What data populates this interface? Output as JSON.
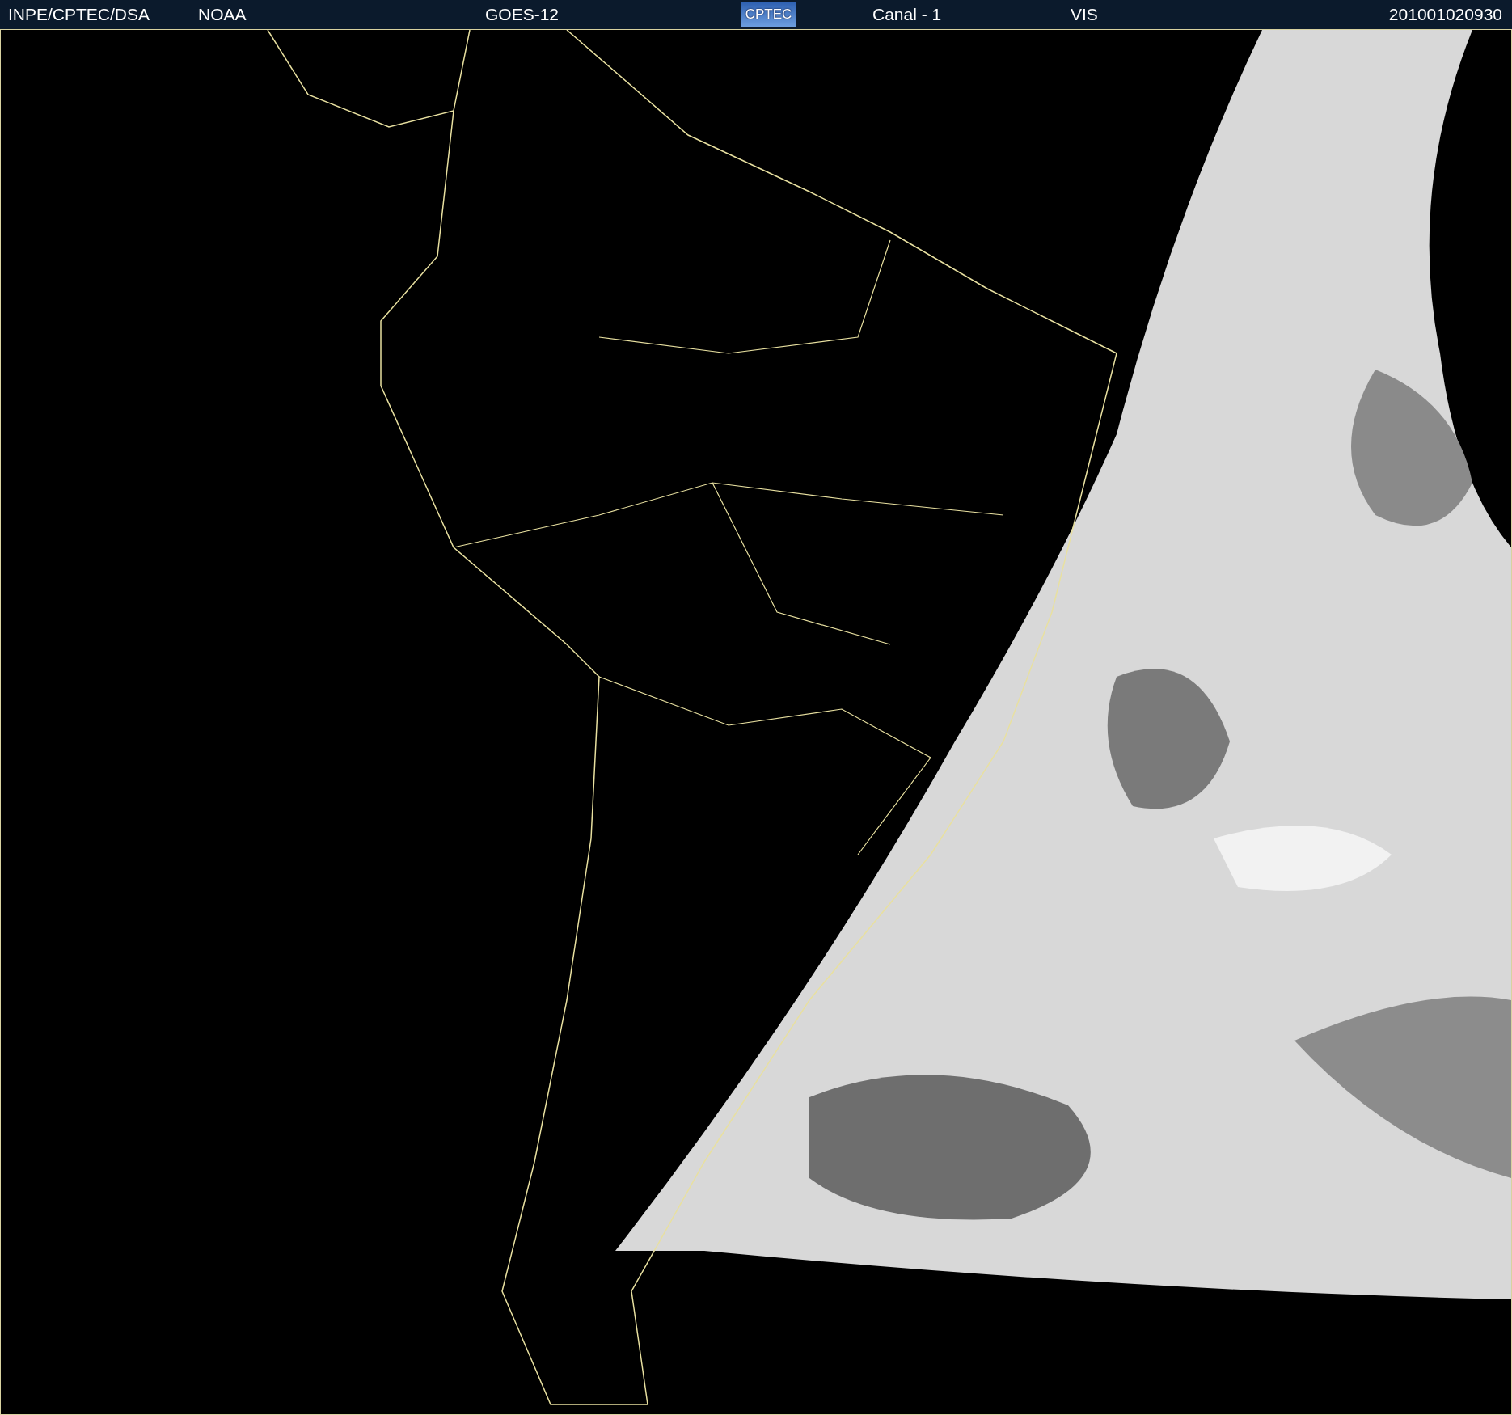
{
  "header": {
    "items": [
      {
        "kind": "text",
        "text": "INPE/CPTEC/DSA"
      },
      {
        "kind": "text",
        "text": "NOAA"
      },
      {
        "kind": "text",
        "text": "GOES-12"
      },
      {
        "kind": "logo",
        "text": "CPTEC"
      },
      {
        "kind": "text",
        "text": "Canal - 1"
      },
      {
        "kind": "text",
        "text": "VIS"
      },
      {
        "kind": "text",
        "text": "201001020930"
      }
    ]
  }
}
